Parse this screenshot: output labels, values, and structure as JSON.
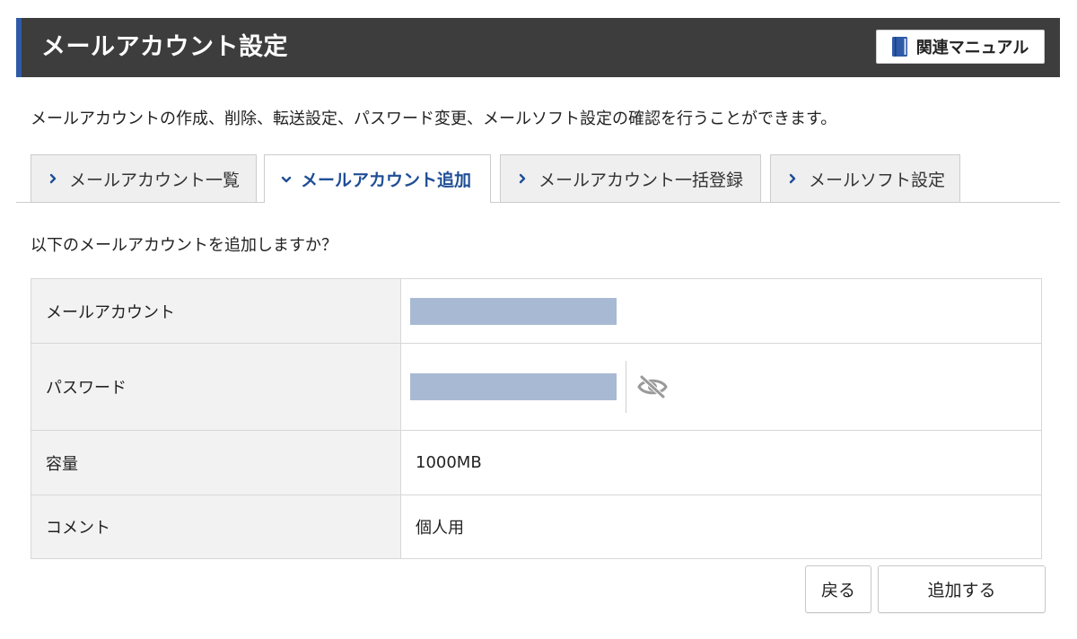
{
  "header": {
    "title": "メールアカウント設定",
    "manual_label": "関連マニュアル",
    "accent_color": "#2e5aa8"
  },
  "description": "メールアカウントの作成、削除、転送設定、パスワード変更、メールソフト設定の確認を行うことができます。",
  "tabs": [
    {
      "label": "メールアカウント一覧",
      "active": false
    },
    {
      "label": "メールアカウント追加",
      "active": true
    },
    {
      "label": "メールアカウント一括登録",
      "active": false
    },
    {
      "label": "メールソフト設定",
      "active": false
    }
  ],
  "confirm": {
    "question": "以下のメールアカウントを追加しますか？",
    "rows": [
      {
        "key": "メールアカウント",
        "value": ""
      },
      {
        "key": "パスワード",
        "value": ""
      },
      {
        "key": "容量",
        "value": "1000MB"
      },
      {
        "key": "コメント",
        "value": "個人用"
      }
    ]
  },
  "buttons": {
    "back": "戻る",
    "add": "追加する"
  },
  "icons": {
    "manual": "book-icon",
    "tab": "chevron-right-icon",
    "tab_active": "chevron-down-icon",
    "password_toggle": "eye-slash-icon"
  }
}
